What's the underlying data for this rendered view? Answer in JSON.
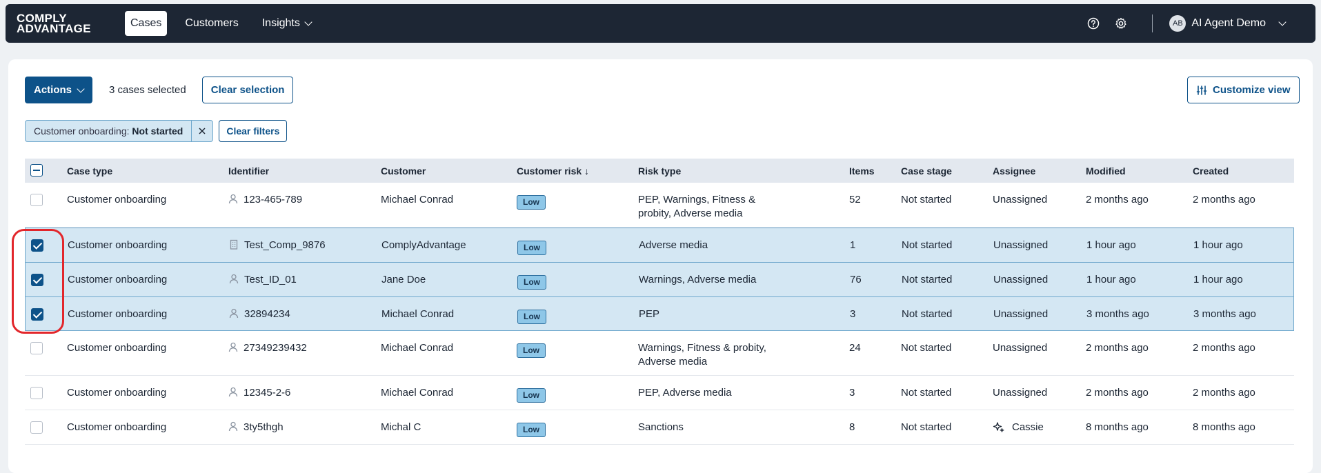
{
  "nav": {
    "logo_line1": "COMPLY",
    "logo_line2": "ADVANTAGE",
    "items": [
      {
        "label": "Cases",
        "active": true
      },
      {
        "label": "Customers",
        "active": false
      },
      {
        "label": "Insights",
        "active": false
      }
    ],
    "user": {
      "initials": "AB",
      "name": "AI Agent Demo"
    }
  },
  "toolbar": {
    "actions_label": "Actions",
    "selected_text": "3 cases selected",
    "clear_selection_label": "Clear selection",
    "customize_label": "Customize view"
  },
  "filters": {
    "chip_key": "Customer onboarding:",
    "chip_value": "Not started",
    "clear_label": "Clear filters"
  },
  "table": {
    "columns": [
      "Case type",
      "Identifier",
      "Customer",
      "Customer risk ↓",
      "Risk type",
      "Items",
      "Case stage",
      "Assignee",
      "Modified",
      "Created"
    ],
    "rows": [
      {
        "selected": false,
        "case_type": "Customer onboarding",
        "id_kind": "person",
        "identifier": "123-465-789",
        "customer": "Michael Conrad",
        "risk": "Low",
        "risk_type_1": "PEP, Warnings, Fitness &",
        "risk_type_2": "probity, Adverse media",
        "items": "52",
        "stage": "Not started",
        "assignee": "Unassigned",
        "modified": "2 months ago",
        "created": "2 months ago"
      },
      {
        "selected": true,
        "case_type": "Customer onboarding",
        "id_kind": "company",
        "identifier": "Test_Comp_9876",
        "customer": "ComplyAdvantage",
        "risk": "Low",
        "risk_type_1": "Adverse media",
        "risk_type_2": "",
        "items": "1",
        "stage": "Not started",
        "assignee": "Unassigned",
        "modified": "1 hour ago",
        "created": "1 hour ago"
      },
      {
        "selected": true,
        "case_type": "Customer onboarding",
        "id_kind": "person",
        "identifier": "Test_ID_01",
        "customer": "Jane Doe",
        "risk": "Low",
        "risk_type_1": "Warnings, Adverse media",
        "risk_type_2": "",
        "items": "76",
        "stage": "Not started",
        "assignee": "Unassigned",
        "modified": "1 hour ago",
        "created": "1 hour ago"
      },
      {
        "selected": true,
        "case_type": "Customer onboarding",
        "id_kind": "person",
        "identifier": "32894234",
        "customer": "Michael Conrad",
        "risk": "Low",
        "risk_type_1": "PEP",
        "risk_type_2": "",
        "items": "3",
        "stage": "Not started",
        "assignee": "Unassigned",
        "modified": "3 months ago",
        "created": "3 months ago"
      },
      {
        "selected": false,
        "case_type": "Customer onboarding",
        "id_kind": "person",
        "identifier": "27349239432",
        "customer": "Michael Conrad",
        "risk": "Low",
        "risk_type_1": "Warnings, Fitness & probity,",
        "risk_type_2": "Adverse media",
        "items": "24",
        "stage": "Not started",
        "assignee": "Unassigned",
        "modified": "2 months ago",
        "created": "2 months ago"
      },
      {
        "selected": false,
        "case_type": "Customer onboarding",
        "id_kind": "person",
        "identifier": "12345-2-6",
        "customer": "Michael Conrad",
        "risk": "Low",
        "risk_type_1": "PEP, Adverse media",
        "risk_type_2": "",
        "items": "3",
        "stage": "Not started",
        "assignee": "Unassigned",
        "modified": "2 months ago",
        "created": "2 months ago"
      },
      {
        "selected": false,
        "case_type": "Customer onboarding",
        "id_kind": "person",
        "identifier": "3ty5thgh",
        "customer": "Michal C",
        "risk": "Low",
        "risk_type_1": "Sanctions",
        "risk_type_2": "",
        "items": "8",
        "stage": "Not started",
        "assignee": "Cassie",
        "assignee_icon": "sparkle-icon",
        "modified": "8 months ago",
        "created": "8 months ago"
      }
    ]
  },
  "colors": {
    "nav_bg": "#1d2634",
    "primary": "#0d5289",
    "selected_row": "#d4e7f3",
    "badge_low": "#8ec7e8",
    "annotation": "#e2262b"
  }
}
